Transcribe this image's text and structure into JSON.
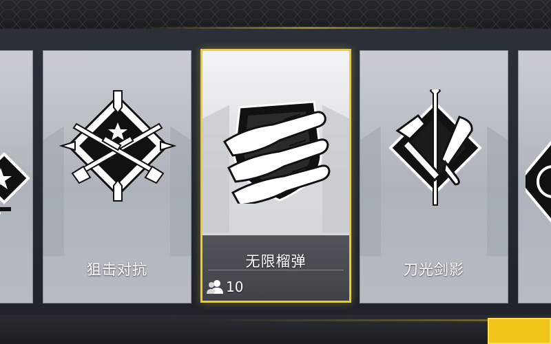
{
  "modes": [
    {
      "name": "",
      "icon": "star-rifle-emblem-icon"
    },
    {
      "name": "狙击对抗",
      "icon": "crossed-sniper-rifles-emblem-icon"
    },
    {
      "name": "无限榴弹",
      "icon": "grenade-launchers-emblem-icon",
      "selected": true,
      "players": "10"
    },
    {
      "name": "刀光剑影",
      "icon": "blades-emblem-icon"
    },
    {
      "name": "",
      "icon": "partial-emblem-icon"
    }
  ],
  "colors": {
    "accent": "#f2cd1f",
    "card": "#b7bcc3",
    "panel": "#46494e"
  }
}
